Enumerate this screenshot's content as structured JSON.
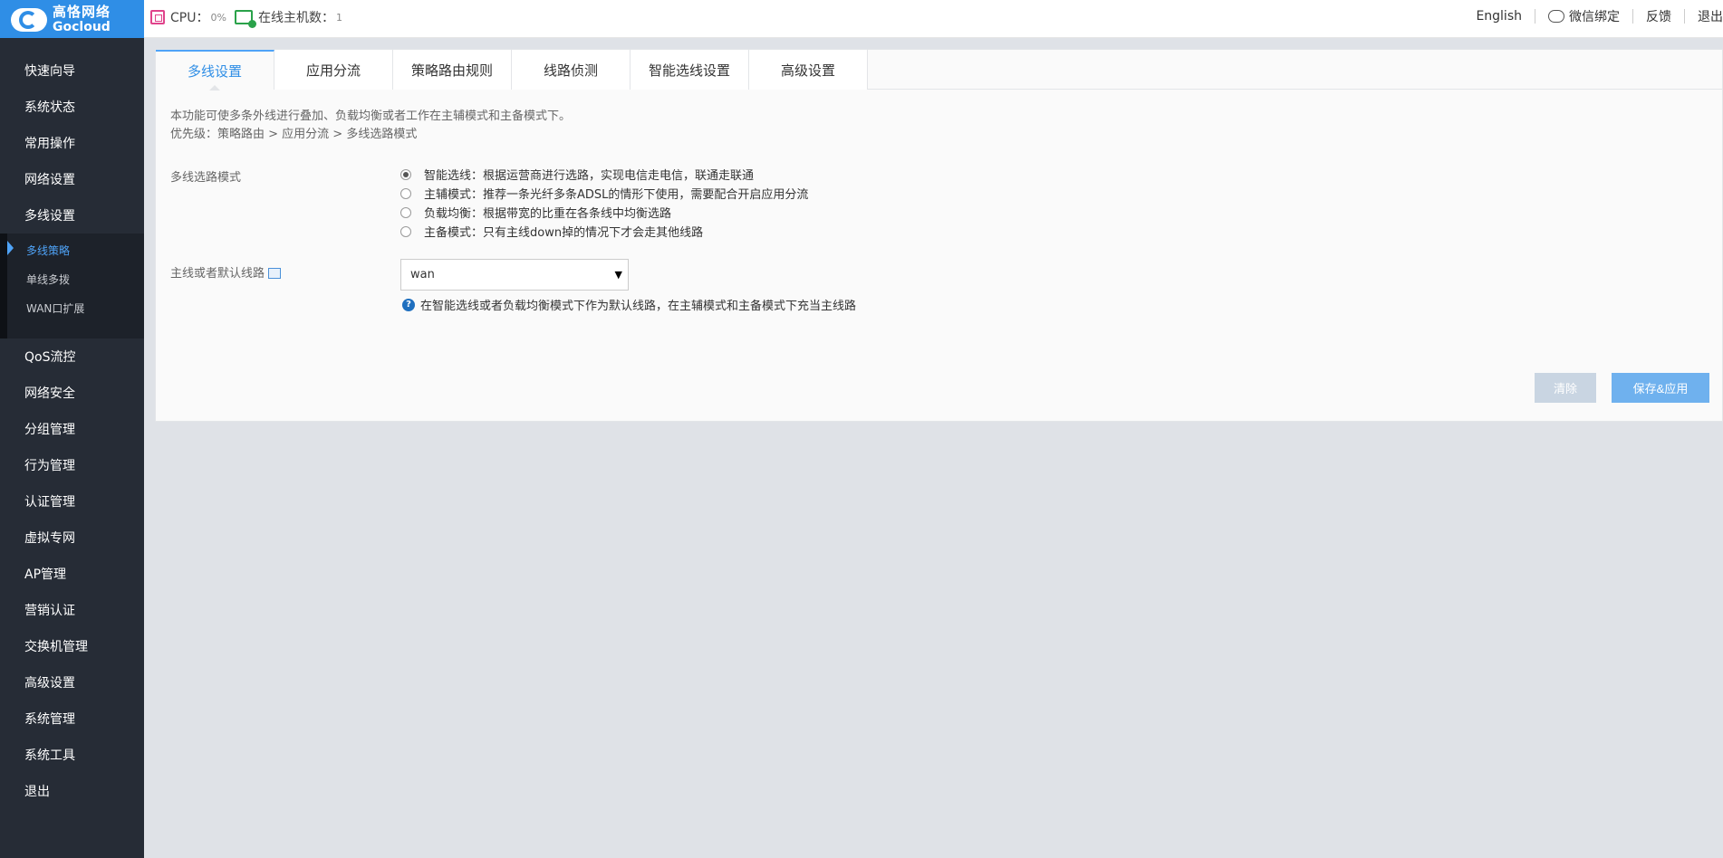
{
  "header": {
    "logo_cn": "高恪网络",
    "logo_en": "Gocloud",
    "cpu_label": "CPU：",
    "cpu_value": "0%",
    "hosts_label": "在线主机数：",
    "hosts_value": "1",
    "links": [
      "English",
      "微信绑定",
      "反馈",
      "退出"
    ]
  },
  "sidebar": {
    "items_top": [
      "快速向导",
      "系统状态",
      "常用操作",
      "网络设置",
      "多线设置"
    ],
    "sub_items": [
      "多线策略",
      "单线多拨",
      "WAN口扩展"
    ],
    "items_bottom": [
      "QoS流控",
      "网络安全",
      "分组管理",
      "行为管理",
      "认证管理",
      "虚拟专网",
      "AP管理",
      "营销认证",
      "交换机管理",
      "高级设置",
      "系统管理",
      "系统工具",
      "退出"
    ]
  },
  "tabs": [
    "多线设置",
    "应用分流",
    "策略路由规则",
    "线路侦测",
    "智能选线设置",
    "高级设置"
  ],
  "content": {
    "desc1": "本功能可使多条外线进行叠加、负载均衡或者工作在主辅模式和主备模式下。",
    "desc2": "优先级：策略路由 > 应用分流 > 多线选路模式",
    "mode_label": "多线选路模式",
    "modes": [
      "智能选线：根据运营商进行选路，实现电信走电信，联通走联通",
      "主辅模式：推荐一条光纤多条ADSL的情形下使用，需要配合开启应用分流",
      "负载均衡：根据带宽的比重在各条线中均衡选路",
      "主备模式：只有主线down掉的情况下才会走其他线路"
    ],
    "default_line_label": "主线或者默认线路",
    "default_line_value": "wan",
    "hint": "在智能选线或者负载均衡模式下作为默认线路，在主辅模式和主备模式下充当主线路",
    "clear_label": "清除",
    "save_label": "保存&应用"
  }
}
